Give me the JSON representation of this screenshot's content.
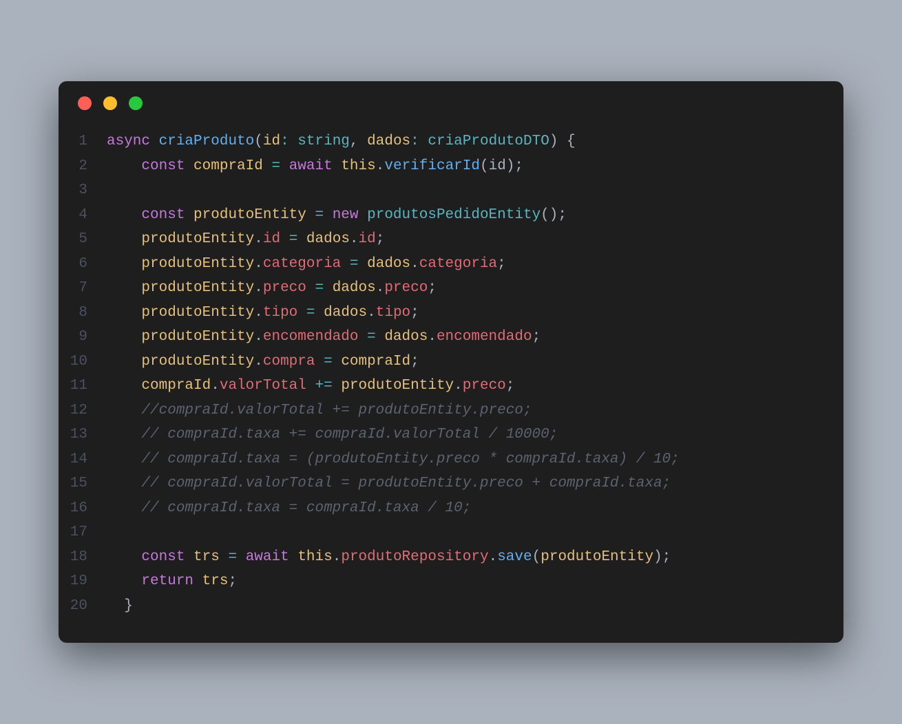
{
  "lines": [
    {
      "num": "1",
      "tokens": [
        {
          "cls": "tk-keyword",
          "text": "async"
        },
        {
          "cls": "tk-plain",
          "text": " "
        },
        {
          "cls": "tk-function",
          "text": "criaProduto"
        },
        {
          "cls": "tk-punct",
          "text": "("
        },
        {
          "cls": "tk-param",
          "text": "id"
        },
        {
          "cls": "tk-operator",
          "text": ":"
        },
        {
          "cls": "tk-plain",
          "text": " "
        },
        {
          "cls": "tk-type",
          "text": "string"
        },
        {
          "cls": "tk-punct",
          "text": ", "
        },
        {
          "cls": "tk-param",
          "text": "dados"
        },
        {
          "cls": "tk-operator",
          "text": ":"
        },
        {
          "cls": "tk-plain",
          "text": " "
        },
        {
          "cls": "tk-type",
          "text": "criaProdutoDTO"
        },
        {
          "cls": "tk-punct",
          "text": ") {"
        }
      ]
    },
    {
      "num": "2",
      "tokens": [
        {
          "cls": "tk-plain",
          "text": "    "
        },
        {
          "cls": "tk-keyword",
          "text": "const"
        },
        {
          "cls": "tk-plain",
          "text": " "
        },
        {
          "cls": "tk-const",
          "text": "compraId"
        },
        {
          "cls": "tk-plain",
          "text": " "
        },
        {
          "cls": "tk-operator",
          "text": "="
        },
        {
          "cls": "tk-plain",
          "text": " "
        },
        {
          "cls": "tk-keyword",
          "text": "await"
        },
        {
          "cls": "tk-plain",
          "text": " "
        },
        {
          "cls": "tk-this",
          "text": "this"
        },
        {
          "cls": "tk-punct",
          "text": "."
        },
        {
          "cls": "tk-method",
          "text": "verificarId"
        },
        {
          "cls": "tk-punct",
          "text": "("
        },
        {
          "cls": "tk-plain",
          "text": "id"
        },
        {
          "cls": "tk-punct",
          "text": ");"
        }
      ]
    },
    {
      "num": "3",
      "tokens": []
    },
    {
      "num": "4",
      "tokens": [
        {
          "cls": "tk-plain",
          "text": "    "
        },
        {
          "cls": "tk-keyword",
          "text": "const"
        },
        {
          "cls": "tk-plain",
          "text": " "
        },
        {
          "cls": "tk-const",
          "text": "produtoEntity"
        },
        {
          "cls": "tk-plain",
          "text": " "
        },
        {
          "cls": "tk-operator",
          "text": "="
        },
        {
          "cls": "tk-plain",
          "text": " "
        },
        {
          "cls": "tk-new",
          "text": "new"
        },
        {
          "cls": "tk-plain",
          "text": " "
        },
        {
          "cls": "tk-class",
          "text": "produtosPedidoEntity"
        },
        {
          "cls": "tk-punct",
          "text": "();"
        }
      ]
    },
    {
      "num": "5",
      "tokens": [
        {
          "cls": "tk-plain",
          "text": "    "
        },
        {
          "cls": "tk-var",
          "text": "produtoEntity"
        },
        {
          "cls": "tk-punct",
          "text": "."
        },
        {
          "cls": "tk-prop",
          "text": "id"
        },
        {
          "cls": "tk-plain",
          "text": " "
        },
        {
          "cls": "tk-operator",
          "text": "="
        },
        {
          "cls": "tk-plain",
          "text": " "
        },
        {
          "cls": "tk-var",
          "text": "dados"
        },
        {
          "cls": "tk-punct",
          "text": "."
        },
        {
          "cls": "tk-prop",
          "text": "id"
        },
        {
          "cls": "tk-punct",
          "text": ";"
        }
      ]
    },
    {
      "num": "6",
      "tokens": [
        {
          "cls": "tk-plain",
          "text": "    "
        },
        {
          "cls": "tk-var",
          "text": "produtoEntity"
        },
        {
          "cls": "tk-punct",
          "text": "."
        },
        {
          "cls": "tk-prop",
          "text": "categoria"
        },
        {
          "cls": "tk-plain",
          "text": " "
        },
        {
          "cls": "tk-operator",
          "text": "="
        },
        {
          "cls": "tk-plain",
          "text": " "
        },
        {
          "cls": "tk-var",
          "text": "dados"
        },
        {
          "cls": "tk-punct",
          "text": "."
        },
        {
          "cls": "tk-prop",
          "text": "categoria"
        },
        {
          "cls": "tk-punct",
          "text": ";"
        }
      ]
    },
    {
      "num": "7",
      "tokens": [
        {
          "cls": "tk-plain",
          "text": "    "
        },
        {
          "cls": "tk-var",
          "text": "produtoEntity"
        },
        {
          "cls": "tk-punct",
          "text": "."
        },
        {
          "cls": "tk-prop",
          "text": "preco"
        },
        {
          "cls": "tk-plain",
          "text": " "
        },
        {
          "cls": "tk-operator",
          "text": "="
        },
        {
          "cls": "tk-plain",
          "text": " "
        },
        {
          "cls": "tk-var",
          "text": "dados"
        },
        {
          "cls": "tk-punct",
          "text": "."
        },
        {
          "cls": "tk-prop",
          "text": "preco"
        },
        {
          "cls": "tk-punct",
          "text": ";"
        }
      ]
    },
    {
      "num": "8",
      "tokens": [
        {
          "cls": "tk-plain",
          "text": "    "
        },
        {
          "cls": "tk-var",
          "text": "produtoEntity"
        },
        {
          "cls": "tk-punct",
          "text": "."
        },
        {
          "cls": "tk-prop",
          "text": "tipo"
        },
        {
          "cls": "tk-plain",
          "text": " "
        },
        {
          "cls": "tk-operator",
          "text": "="
        },
        {
          "cls": "tk-plain",
          "text": " "
        },
        {
          "cls": "tk-var",
          "text": "dados"
        },
        {
          "cls": "tk-punct",
          "text": "."
        },
        {
          "cls": "tk-prop",
          "text": "tipo"
        },
        {
          "cls": "tk-punct",
          "text": ";"
        }
      ]
    },
    {
      "num": "9",
      "tokens": [
        {
          "cls": "tk-plain",
          "text": "    "
        },
        {
          "cls": "tk-var",
          "text": "produtoEntity"
        },
        {
          "cls": "tk-punct",
          "text": "."
        },
        {
          "cls": "tk-prop",
          "text": "encomendado"
        },
        {
          "cls": "tk-plain",
          "text": " "
        },
        {
          "cls": "tk-operator",
          "text": "="
        },
        {
          "cls": "tk-plain",
          "text": " "
        },
        {
          "cls": "tk-var",
          "text": "dados"
        },
        {
          "cls": "tk-punct",
          "text": "."
        },
        {
          "cls": "tk-prop",
          "text": "encomendado"
        },
        {
          "cls": "tk-punct",
          "text": ";"
        }
      ]
    },
    {
      "num": "10",
      "tokens": [
        {
          "cls": "tk-plain",
          "text": "    "
        },
        {
          "cls": "tk-var",
          "text": "produtoEntity"
        },
        {
          "cls": "tk-punct",
          "text": "."
        },
        {
          "cls": "tk-prop",
          "text": "compra"
        },
        {
          "cls": "tk-plain",
          "text": " "
        },
        {
          "cls": "tk-operator",
          "text": "="
        },
        {
          "cls": "tk-plain",
          "text": " "
        },
        {
          "cls": "tk-var",
          "text": "compraId"
        },
        {
          "cls": "tk-punct",
          "text": ";"
        }
      ]
    },
    {
      "num": "11",
      "tokens": [
        {
          "cls": "tk-plain",
          "text": "    "
        },
        {
          "cls": "tk-var",
          "text": "compraId"
        },
        {
          "cls": "tk-punct",
          "text": "."
        },
        {
          "cls": "tk-prop",
          "text": "valorTotal"
        },
        {
          "cls": "tk-plain",
          "text": " "
        },
        {
          "cls": "tk-operator",
          "text": "+="
        },
        {
          "cls": "tk-plain",
          "text": " "
        },
        {
          "cls": "tk-var",
          "text": "produtoEntity"
        },
        {
          "cls": "tk-punct",
          "text": "."
        },
        {
          "cls": "tk-prop",
          "text": "preco"
        },
        {
          "cls": "tk-punct",
          "text": ";"
        }
      ]
    },
    {
      "num": "12",
      "tokens": [
        {
          "cls": "tk-plain",
          "text": "    "
        },
        {
          "cls": "tk-comment",
          "text": "//compraId.valorTotal += produtoEntity.preco;"
        }
      ]
    },
    {
      "num": "13",
      "tokens": [
        {
          "cls": "tk-plain",
          "text": "    "
        },
        {
          "cls": "tk-comment",
          "text": "// compraId.taxa += compraId.valorTotal / 10000;"
        }
      ]
    },
    {
      "num": "14",
      "tokens": [
        {
          "cls": "tk-plain",
          "text": "    "
        },
        {
          "cls": "tk-comment",
          "text": "// compraId.taxa = (produtoEntity.preco * compraId.taxa) / 10;"
        }
      ]
    },
    {
      "num": "15",
      "tokens": [
        {
          "cls": "tk-plain",
          "text": "    "
        },
        {
          "cls": "tk-comment",
          "text": "// compraId.valorTotal = produtoEntity.preco + compraId.taxa;"
        }
      ]
    },
    {
      "num": "16",
      "tokens": [
        {
          "cls": "tk-plain",
          "text": "    "
        },
        {
          "cls": "tk-comment",
          "text": "// compraId.taxa = compraId.taxa / 10;"
        }
      ]
    },
    {
      "num": "17",
      "tokens": []
    },
    {
      "num": "18",
      "tokens": [
        {
          "cls": "tk-plain",
          "text": "    "
        },
        {
          "cls": "tk-keyword",
          "text": "const"
        },
        {
          "cls": "tk-plain",
          "text": " "
        },
        {
          "cls": "tk-const",
          "text": "trs"
        },
        {
          "cls": "tk-plain",
          "text": " "
        },
        {
          "cls": "tk-operator",
          "text": "="
        },
        {
          "cls": "tk-plain",
          "text": " "
        },
        {
          "cls": "tk-keyword",
          "text": "await"
        },
        {
          "cls": "tk-plain",
          "text": " "
        },
        {
          "cls": "tk-this",
          "text": "this"
        },
        {
          "cls": "tk-punct",
          "text": "."
        },
        {
          "cls": "tk-prop",
          "text": "produtoRepository"
        },
        {
          "cls": "tk-punct",
          "text": "."
        },
        {
          "cls": "tk-method",
          "text": "save"
        },
        {
          "cls": "tk-punct",
          "text": "("
        },
        {
          "cls": "tk-var",
          "text": "produtoEntity"
        },
        {
          "cls": "tk-punct",
          "text": ");"
        }
      ]
    },
    {
      "num": "19",
      "tokens": [
        {
          "cls": "tk-plain",
          "text": "    "
        },
        {
          "cls": "tk-keyword",
          "text": "return"
        },
        {
          "cls": "tk-plain",
          "text": " "
        },
        {
          "cls": "tk-var",
          "text": "trs"
        },
        {
          "cls": "tk-punct",
          "text": ";"
        }
      ]
    },
    {
      "num": "20",
      "tokens": [
        {
          "cls": "tk-plain",
          "text": "  "
        },
        {
          "cls": "tk-punct",
          "text": "}"
        }
      ]
    }
  ]
}
